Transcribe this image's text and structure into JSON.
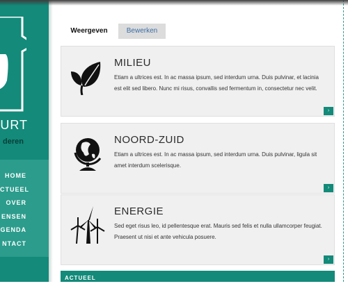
{
  "sidebar": {
    "brand_fragment": "HURT",
    "brand_sub_fragment": "deren",
    "nav_items": [
      {
        "label": "HOME"
      },
      {
        "label": "CTUEEL"
      },
      {
        "label": "OVER"
      },
      {
        "label": "ENSEN"
      },
      {
        "label": "GENDA"
      },
      {
        "label": "NTACT"
      }
    ]
  },
  "tabs": [
    {
      "label": "Weergeven",
      "active": true
    },
    {
      "label": "Bewerken",
      "active": false
    }
  ],
  "cards": [
    {
      "title": "MILIEU",
      "body": "Etiam a ultrices est. In ac massa ipsum, sed interdum urna. Duis pulvinar, et lacinia est elit sed libero. Nunc mi risus, convallis sed fermentum in, consectetur nec velit.",
      "icon": "leaf-icon",
      "more": "›"
    },
    {
      "title": "NOORD-ZUID",
      "body": "Etiam a ultrices est. In ac massa ipsum, sed interdum urna. Duis pulvinar, ligula sit amet interdum scelerisque.",
      "icon": "globe-icon",
      "more": "›"
    },
    {
      "title": "ENERGIE",
      "body": "Sed eget risus leo, id pellentesque erat. Mauris sed felis et nulla ullamcorper feugiat. Praesent ut nisi et ante vehicula posuere.",
      "icon": "wind-turbine-icon",
      "more": "›"
    }
  ],
  "section_heading": "ACTUEEL",
  "colors": {
    "brand": "#138a7a",
    "nav_background": "#2c9c8c",
    "card_background": "#f0f0f0",
    "tab_inactive": "#dcdcdc",
    "link": "#3a6da5"
  }
}
